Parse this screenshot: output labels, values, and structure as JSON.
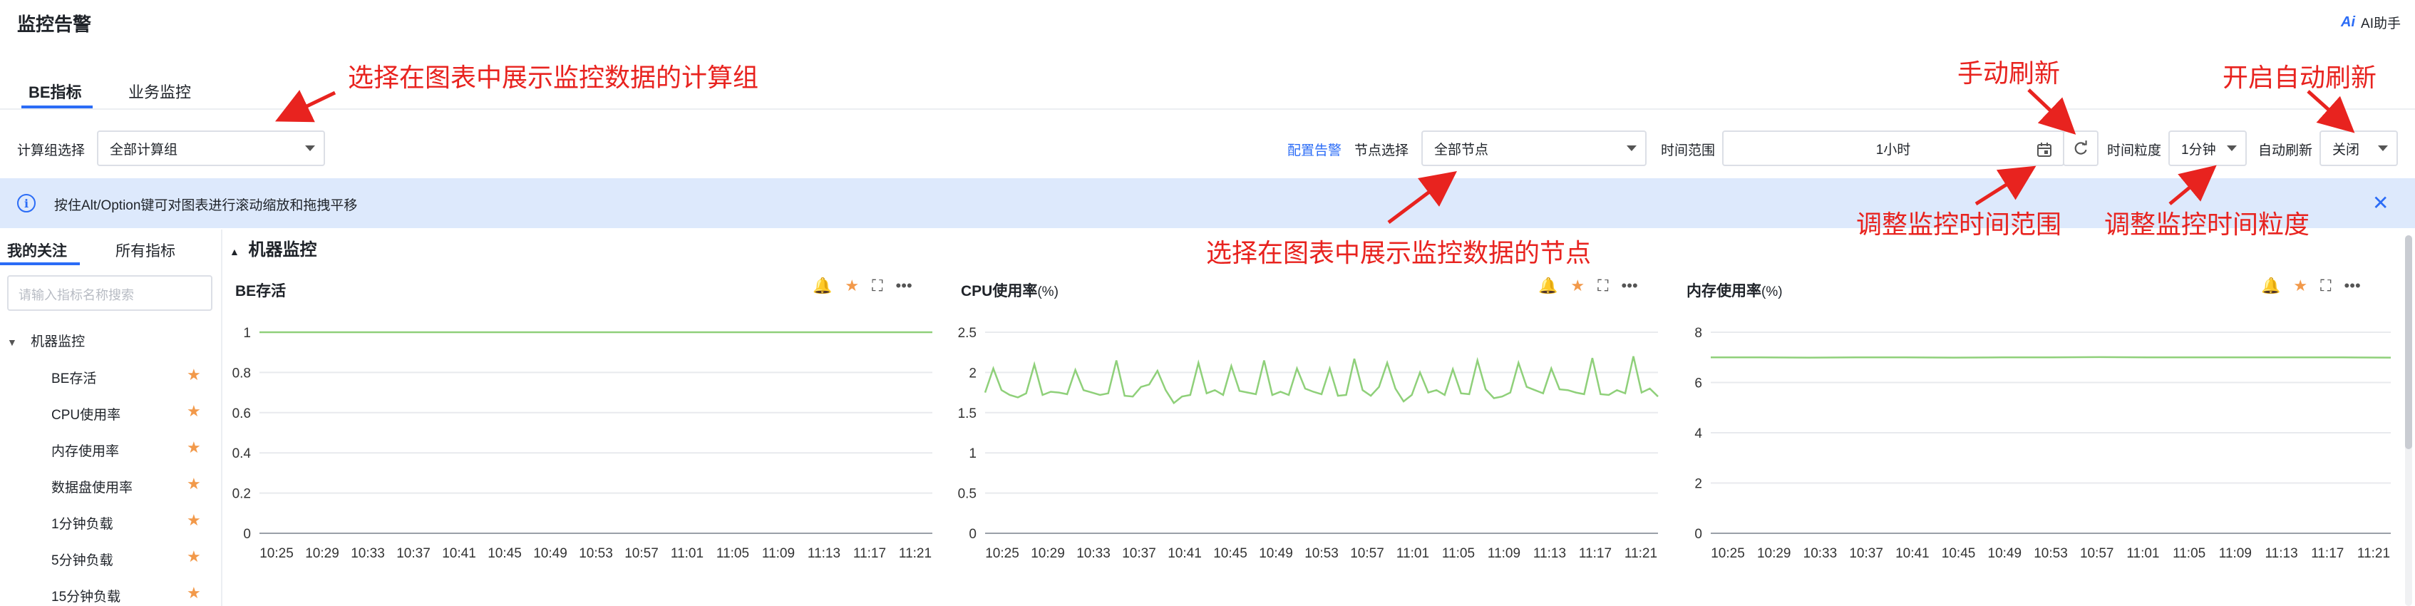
{
  "header": {
    "title": "监控告警",
    "ai_logo": "Ai",
    "ai_label": "AI助手"
  },
  "tabs": [
    {
      "label": "BE指标"
    },
    {
      "label": "业务监控"
    }
  ],
  "filters": {
    "compute_group_label": "计算组选择",
    "compute_group_value": "全部计算组",
    "configure_alert": "配置告警",
    "node_label": "节点选择",
    "node_value": "全部节点",
    "time_range_label": "时间范围",
    "time_range_value": "1小时",
    "granularity_label": "时间粒度",
    "granularity_value": "1分钟",
    "auto_refresh_label": "自动刷新",
    "auto_refresh_value": "关闭"
  },
  "info_bar": {
    "text": "按住Alt/Option键可对图表进行滚动缩放和拖拽平移"
  },
  "sidebar": {
    "tabs": [
      {
        "label": "我的关注"
      },
      {
        "label": "所有指标"
      }
    ],
    "search_placeholder": "请输入指标名称搜索",
    "tree_root": "机器监控",
    "items": [
      {
        "label": "BE存活"
      },
      {
        "label": "CPU使用率"
      },
      {
        "label": "内存使用率"
      },
      {
        "label": "数据盘使用率"
      },
      {
        "label": "1分钟负载"
      },
      {
        "label": "5分钟负载"
      },
      {
        "label": "15分钟负载"
      }
    ]
  },
  "section": {
    "title": "机器监控"
  },
  "charts": [
    {
      "title": "BE存活",
      "unit": ""
    },
    {
      "title": "CPU使用率",
      "unit": "(%)"
    },
    {
      "title": "内存使用率",
      "unit": "(%)"
    }
  ],
  "chart_data": [
    {
      "type": "line",
      "title": "BE存活",
      "x": [
        "10:25",
        "10:29",
        "10:33",
        "10:37",
        "10:41",
        "10:45",
        "10:49",
        "10:53",
        "10:57",
        "11:01",
        "11:05",
        "11:09",
        "11:13",
        "11:17",
        "11:21"
      ],
      "ylim": [
        0,
        1
      ],
      "yticks": [
        "0",
        "0.2",
        "0.4",
        "0.6",
        "0.8",
        "1"
      ],
      "series": [
        {
          "values": [
            1,
            1,
            1,
            1,
            1,
            1,
            1,
            1,
            1,
            1,
            1,
            1,
            1,
            1,
            1
          ]
        }
      ],
      "colors": [
        "#8fd07a"
      ]
    },
    {
      "type": "line",
      "title": "CPU使用率(%)",
      "x": [
        "10:25",
        "10:29",
        "10:33",
        "10:37",
        "10:41",
        "10:45",
        "10:49",
        "10:53",
        "10:57",
        "11:01",
        "11:05",
        "11:09",
        "11:13",
        "11:17",
        "11:21"
      ],
      "ylim": [
        0,
        2.5
      ],
      "yticks": [
        "0",
        "0.5",
        "1",
        "1.5",
        "2",
        "2.5"
      ],
      "series": [
        {
          "values": [
            1.75,
            2.05,
            1.78,
            1.72,
            1.69,
            1.74,
            2.1,
            1.72,
            1.76,
            1.75,
            1.73,
            2.03,
            1.78,
            1.75,
            1.72,
            1.74,
            2.15,
            1.71,
            1.7,
            1.82,
            1.85,
            2.02,
            1.78,
            1.62,
            1.7,
            1.72,
            2.12,
            1.74,
            1.78,
            1.72,
            2.08,
            1.77,
            1.75,
            1.73,
            2.15,
            1.72,
            1.76,
            1.72,
            2.05,
            1.8,
            1.76,
            1.73,
            2.05,
            1.71,
            1.72,
            2.17,
            1.78,
            1.71,
            1.82,
            2.12,
            1.8,
            1.64,
            1.72,
            2.0,
            1.75,
            1.78,
            1.72,
            2.04,
            1.74,
            1.73,
            2.15,
            1.79,
            1.68,
            1.7,
            1.75,
            2.12,
            1.82,
            1.78,
            1.74,
            2.05,
            1.79,
            1.78,
            1.75,
            1.73,
            2.18,
            1.73,
            1.72,
            1.78,
            1.74,
            2.2,
            1.75,
            1.8,
            1.7
          ]
        }
      ],
      "colors": [
        "#8fd07a"
      ]
    },
    {
      "type": "line",
      "title": "内存使用率(%)",
      "x": [
        "10:25",
        "10:29",
        "10:33",
        "10:37",
        "10:41",
        "10:45",
        "10:49",
        "10:53",
        "10:57",
        "11:01",
        "11:05",
        "11:09",
        "11:13",
        "11:17",
        "11:21"
      ],
      "ylim": [
        0,
        8
      ],
      "yticks": [
        "0",
        "2",
        "4",
        "6",
        "8"
      ],
      "series": [
        {
          "values": [
            7.0,
            7.0,
            6.99,
            7.0,
            7.0,
            6.99,
            7.0,
            7.0,
            7.01,
            7.0,
            7.0,
            7.0,
            7.0,
            7.0,
            6.99
          ]
        }
      ],
      "colors": [
        "#8fd07a"
      ]
    }
  ],
  "annotations": {
    "compute_group": "选择在图表中展示监控数据的计算组",
    "manual_refresh": "手动刷新",
    "auto_refresh": "开启自动刷新",
    "node": "选择在图表中展示监控数据的节点",
    "time_range": "调整监控时间范围",
    "granularity": "调整监控时间粒度"
  },
  "colors": {
    "accent": "#2b6cf6",
    "annotation": "#e8231f",
    "series": "#8fd07a",
    "star": "#f2994a"
  }
}
